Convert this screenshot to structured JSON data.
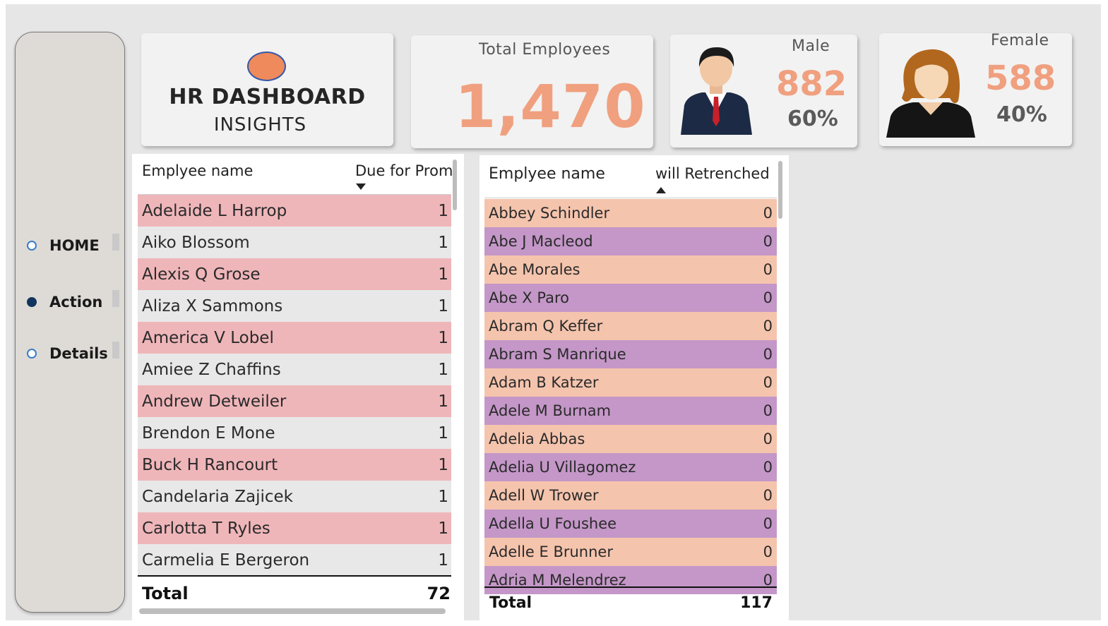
{
  "nav": {
    "items": [
      {
        "label": "HOME",
        "selected": false
      },
      {
        "label": "Action",
        "selected": true
      },
      {
        "label": "Details",
        "selected": false
      }
    ]
  },
  "header": {
    "title": "HR DASHBOARD",
    "subtitle": "INSIGHTS"
  },
  "kpis": {
    "total": {
      "label": "Total Employees",
      "value": "1,470"
    },
    "male": {
      "label": "Male",
      "value": "882",
      "percent": "60%"
    },
    "female": {
      "label": "Female",
      "value": "588",
      "percent": "40%"
    }
  },
  "promotion_table": {
    "col_name": "Emplyee name",
    "col_value": "Due for Prom",
    "sort": "descending",
    "rows": [
      {
        "name": "Adelaide L Harrop",
        "value": "1"
      },
      {
        "name": "Aiko Blossom",
        "value": "1"
      },
      {
        "name": "Alexis Q Grose",
        "value": "1"
      },
      {
        "name": "Aliza X Sammons",
        "value": "1"
      },
      {
        "name": "America V Lobel",
        "value": "1"
      },
      {
        "name": "Amiee Z Chaffins",
        "value": "1"
      },
      {
        "name": "Andrew Detweiler",
        "value": "1"
      },
      {
        "name": "Brendon E Mone",
        "value": "1"
      },
      {
        "name": "Buck H Rancourt",
        "value": "1"
      },
      {
        "name": "Candelaria Zajicek",
        "value": "1"
      },
      {
        "name": "Carlotta T Ryles",
        "value": "1"
      },
      {
        "name": "Carmelia E Bergeron",
        "value": "1"
      }
    ],
    "total_label": "Total",
    "total_value": "72",
    "row_colors": [
      "#efb6ba",
      "#e8e8e8"
    ]
  },
  "retrench_table": {
    "col_name": "Emplyee name",
    "col_value": "will Retrenched",
    "sort": "ascending",
    "rows": [
      {
        "name": "Abbey Schindler",
        "value": "0"
      },
      {
        "name": "Abe J Macleod",
        "value": "0"
      },
      {
        "name": "Abe Morales",
        "value": "0"
      },
      {
        "name": "Abe X Paro",
        "value": "0"
      },
      {
        "name": "Abram Q Keffer",
        "value": "0"
      },
      {
        "name": "Abram S Manrique",
        "value": "0"
      },
      {
        "name": "Adam B Katzer",
        "value": "0"
      },
      {
        "name": "Adele M Burnam",
        "value": "0"
      },
      {
        "name": "Adelia Abbas",
        "value": "0"
      },
      {
        "name": "Adelia U Villagomez",
        "value": "0"
      },
      {
        "name": "Adell W Trower",
        "value": "0"
      },
      {
        "name": "Adella U Foushee",
        "value": "0"
      },
      {
        "name": "Adelle E Brunner",
        "value": "0"
      },
      {
        "name": "Adria M Melendrez",
        "value": "0"
      }
    ],
    "total_label": "Total",
    "total_value": "117",
    "row_colors": [
      "#f5c4ad",
      "#c497c8"
    ]
  }
}
